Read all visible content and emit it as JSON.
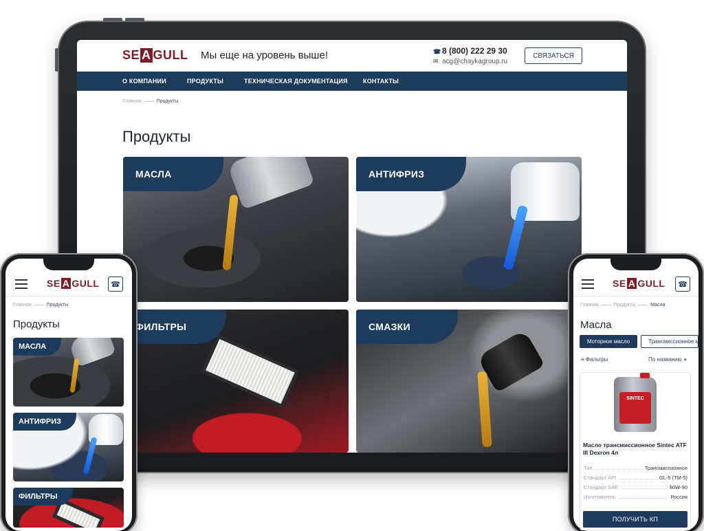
{
  "brand": {
    "logo_left": "SE",
    "logo_mid": "A",
    "logo_right": "GULL",
    "accent": "#1e3a5c",
    "logo_color": "#7a1f26"
  },
  "desktop": {
    "tagline": "Мы еще на уровень выше!",
    "phone": "8 (800) 222 29 30",
    "email": "acg@chaykagroup.ru",
    "contact_button": "СВЯЗАТЬСЯ",
    "nav": [
      "О КОМПАНИИ",
      "ПРОДУКТЫ",
      "ТЕХНИЧЕСКАЯ ДОКУМЕНТАЦИЯ",
      "КОНТАКТЫ"
    ],
    "breadcrumbs": [
      "Главная",
      "Продукты"
    ],
    "title": "Продукты",
    "categories": [
      "МАСЛА",
      "АНТИФРИЗ",
      "ФИЛЬТРЫ",
      "СМАЗКИ"
    ]
  },
  "mobile_left": {
    "breadcrumbs": [
      "Главная",
      "Продукты"
    ],
    "title": "Продукты",
    "categories": [
      "МАСЛА",
      "АНТИФРИЗ",
      "ФИЛЬТРЫ"
    ]
  },
  "mobile_right": {
    "breadcrumbs": [
      "Главная",
      "Продукты",
      "Масла"
    ],
    "title": "Масла",
    "tabs": [
      "Моторное масло",
      "Трансмиссионное м"
    ],
    "filters_label": "Фильтры",
    "sort_label": "По названию",
    "product": {
      "label_brand": "SINTEC",
      "name": "Масло трансмиссионное Sintec ATF III Dexron 4л",
      "specs": [
        {
          "key": "Тип",
          "value": "Трансмиссионное"
        },
        {
          "key": "Стандарт API",
          "value": "GL-5 (ТМ-5)"
        },
        {
          "key": "Стандарт SAE",
          "value": "80W-90"
        },
        {
          "key": "Изготовитель",
          "value": "Россия"
        }
      ],
      "cta": "ПОЛУЧИТЬ КП"
    }
  }
}
